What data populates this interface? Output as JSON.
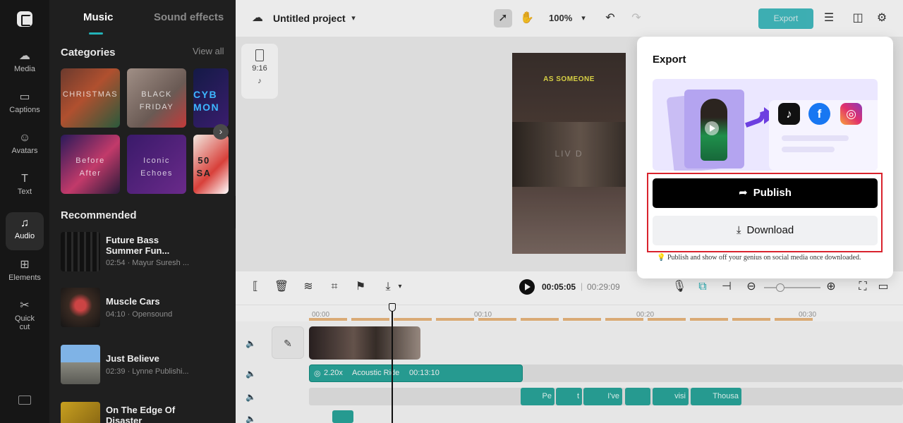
{
  "rail": {
    "items": [
      {
        "label": "Media",
        "icon": "cloud-upload-icon"
      },
      {
        "label": "Captions",
        "icon": "captions-icon"
      },
      {
        "label": "Avatars",
        "icon": "avatar-icon"
      },
      {
        "label": "Text",
        "icon": "text-icon"
      },
      {
        "label": "Audio",
        "icon": "music-note-icon",
        "active": true
      },
      {
        "label": "Elements",
        "icon": "elements-icon"
      },
      {
        "label": "Quick",
        "icon": "quick-cut-icon"
      }
    ],
    "quick_line2": "cut"
  },
  "music_panel": {
    "tab_music": "Music",
    "tab_sound_effects": "Sound effects",
    "categories_title": "Categories",
    "view_all": "View all",
    "categories": [
      {
        "label": "CHRISTMAS"
      },
      {
        "label": "BLACK FRIDAY"
      },
      {
        "label": "CYB MON"
      },
      {
        "label": "Before After"
      },
      {
        "label": "Iconic Echoes"
      },
      {
        "label": "50 SA"
      }
    ],
    "recommended_title": "Recommended",
    "tracks": [
      {
        "title": "Future Bass Summer Fun...",
        "meta": "02:54 · Mayur Suresh ..."
      },
      {
        "title": "Muscle Cars",
        "meta": "04:10 · Opensound"
      },
      {
        "title": "Just Believe",
        "meta": "02:39 · Lynne Publishi..."
      },
      {
        "title": "On The Edge Of Disaster",
        "meta": ""
      }
    ]
  },
  "topbar": {
    "project_title": "Untitled project",
    "zoom": "100%",
    "export_label": "Export"
  },
  "canvas": {
    "ratio_label": "9:16",
    "caption_top": "AS SOMEONE",
    "caption_mid": "LIV D"
  },
  "timeline": {
    "current_time": "00:05:05",
    "separator": "|",
    "total_time": "00:29:09",
    "ruler": [
      "00:00",
      "00:10",
      "00:20",
      "00:30"
    ],
    "audio_clip": {
      "speed": "2.20x",
      "name": "Acoustic Ride",
      "duration": "00:13:10"
    },
    "caption_clips": [
      "Pe",
      "t",
      "I've",
      "",
      "visi",
      "Thousa"
    ]
  },
  "export_modal": {
    "title": "Export",
    "publish_label": "Publish",
    "download_label": "Download",
    "tip": "Publish and show off your genius on social media once downloaded.",
    "social_icons": [
      "tiktok-icon",
      "facebook-icon",
      "instagram-icon"
    ],
    "highlight_color": "#d9232d"
  },
  "colors": {
    "accent": "#23b2b8",
    "audio_clip": "#2aa89d"
  }
}
